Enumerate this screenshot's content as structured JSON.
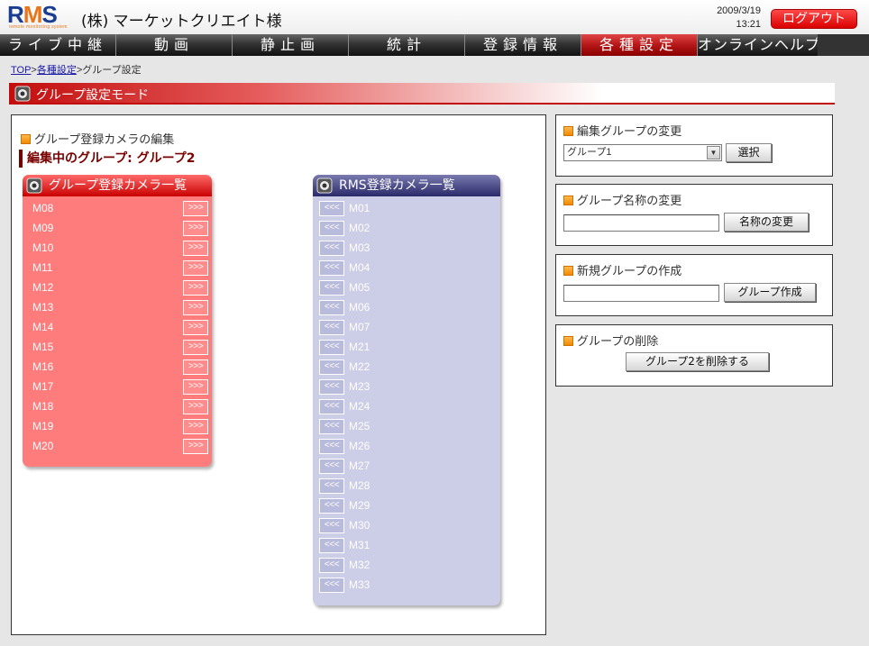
{
  "header": {
    "logo_r": "R",
    "logo_m": "M",
    "logo_s": "S",
    "logo_sub": "remote monitoring system",
    "company": "(株) マーケットクリエイト様",
    "date": "2009/3/19",
    "time": "13:21",
    "logout_label": "ログアウト"
  },
  "nav": {
    "items": [
      "ライブ中継",
      "動画",
      "静止画",
      "統計",
      "登録情報",
      "各種設定",
      "オンラインヘルプ"
    ],
    "active_index": 5
  },
  "breadcrumb": {
    "top": "TOP",
    "sep1": ">",
    "settings": "各種設定",
    "sep2": ">",
    "current": "グループ設定"
  },
  "mode_bar": {
    "title": "グループ設定モード"
  },
  "main": {
    "edit_heading": "グループ登録カメラの編集",
    "editing_group": "編集中のグループ: グループ2",
    "group_list": {
      "title": "グループ登録カメラ一覧",
      "button_label": ">>>",
      "items": [
        "M08",
        "M09",
        "M10",
        "M11",
        "M12",
        "M13",
        "M14",
        "M15",
        "M16",
        "M17",
        "M18",
        "M19",
        "M20"
      ]
    },
    "rms_list": {
      "title": "RMS登録カメラ一覧",
      "button_label": "<<<",
      "items": [
        "M01",
        "M02",
        "M03",
        "M04",
        "M05",
        "M06",
        "M07",
        "M21",
        "M22",
        "M23",
        "M24",
        "M25",
        "M26",
        "M27",
        "M28",
        "M29",
        "M30",
        "M31",
        "M32",
        "M33"
      ]
    }
  },
  "side": {
    "change_group": {
      "title": "編集グループの変更",
      "selected": "グループ1",
      "button": "選択"
    },
    "rename_group": {
      "title": "グループ名称の変更",
      "input_value": "",
      "button": "名称の変更"
    },
    "create_group": {
      "title": "新規グループの作成",
      "input_value": "",
      "button": "グループ作成"
    },
    "delete_group": {
      "title": "グループの削除",
      "button": "グループ2を削除する"
    }
  },
  "colors": {
    "accent_red": "#c20d0d",
    "group_list_bg": "#ff7c7c",
    "rms_list_bg": "#cccde6",
    "logo_blue": "#1a3d91",
    "logo_orange": "#e8751a"
  }
}
